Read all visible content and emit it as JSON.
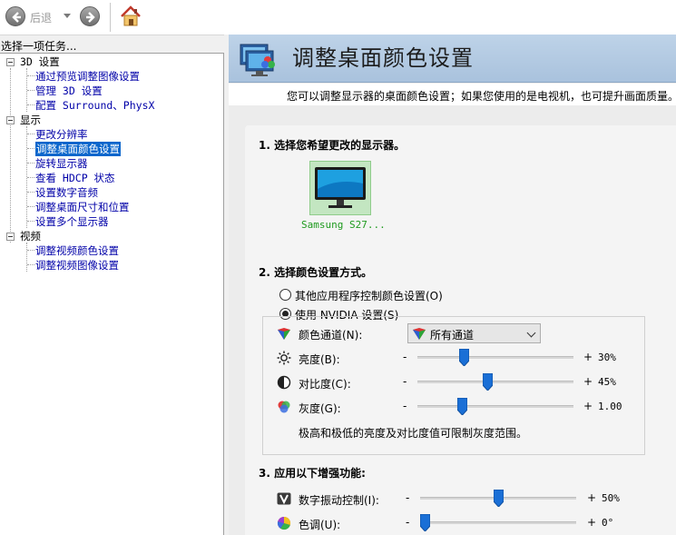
{
  "toolbar": {
    "back_label": "后退"
  },
  "left_panel": {
    "header": "选择一项任务...",
    "categories": [
      {
        "label": "3D 设置",
        "items": [
          "通过预览调整图像设置",
          "管理 3D 设置",
          "配置 Surround、PhysX"
        ]
      },
      {
        "label": "显示",
        "items": [
          "更改分辨率",
          "调整桌面颜色设置",
          "旋转显示器",
          "查看 HDCP 状态",
          "设置数字音频",
          "调整桌面尺寸和位置",
          "设置多个显示器"
        ]
      },
      {
        "label": "视频",
        "items": [
          "调整视频颜色设置",
          "调整视频图像设置"
        ]
      }
    ],
    "selected_item": "调整桌面颜色设置"
  },
  "page": {
    "title": "调整桌面颜色设置",
    "description": "您可以调整显示器的桌面颜色设置；如果您使用的是电视机，也可提升画面质量。"
  },
  "section1": {
    "title": "1. 选择您希望更改的显示器。",
    "monitor_label": "Samsung S27..."
  },
  "section2": {
    "title": "2. 选择颜色设置方式。",
    "option_other": "其他应用程序控制颜色设置(O)",
    "option_nvidia": "使用 NVIDIA 设置(S)",
    "selected_option": "使用 NVIDIA 设置(S)",
    "channel_label": "颜色通道(N):",
    "channel_value": "所有通道",
    "minus": "-",
    "plus": "+",
    "brightness": {
      "label": "亮度(B):",
      "value": "30%",
      "level": 0.3
    },
    "contrast": {
      "label": "对比度(C):",
      "value": "45%",
      "level": 0.45
    },
    "gamma": {
      "label": "灰度(G):",
      "value": "1.00",
      "level": 0.29
    },
    "note": "极高和极低的亮度及对比度值可限制灰度范围。"
  },
  "section3": {
    "title": "3. 应用以下增强功能:",
    "vibrance": {
      "label": "数字振动控制(I):",
      "value": "50%",
      "level": 0.5
    },
    "hue": {
      "label": "色调(U):",
      "value": "0°",
      "level": 0.03
    }
  },
  "colors": {
    "selection": "#0a66cc",
    "link": "#0000a8",
    "monitor_label": "#1e9a1e",
    "banner": "#b4cbe3"
  }
}
